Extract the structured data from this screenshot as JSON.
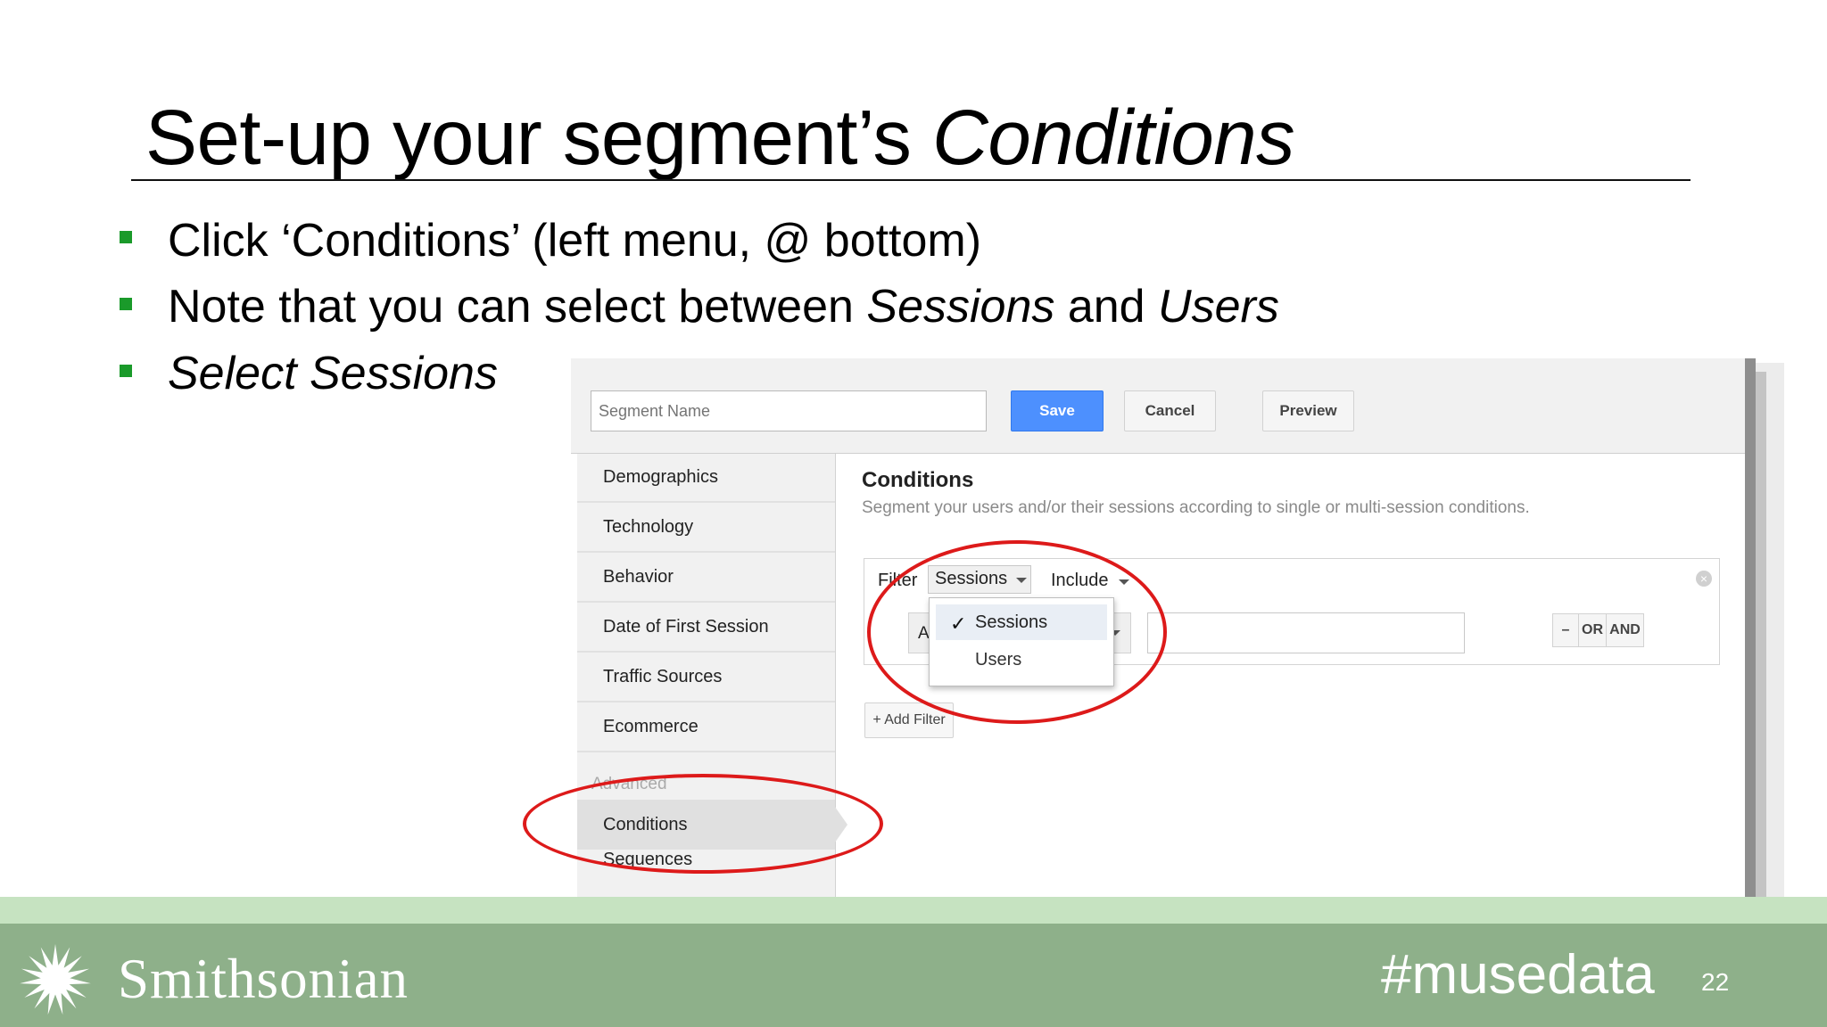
{
  "slide": {
    "title_main": "Set-up your segment’s ",
    "title_emph": "Conditions",
    "bullets": [
      {
        "p1": "Click ‘Conditions’ (left menu, @ bottom)"
      },
      {
        "p1": "Note that you can select between ",
        "e1": "Sessions",
        "p2": " and ",
        "e2": "Users"
      },
      {
        "e1": "Select",
        "p1": " ",
        "e2": "Sessions"
      }
    ],
    "bullet_color": "#1a9a2a"
  },
  "toolbar": {
    "segment_name_placeholder": "Segment Name",
    "save_label": "Save",
    "cancel_label": "Cancel",
    "preview_label": "Preview"
  },
  "nav": {
    "items": [
      "Demographics",
      "Technology",
      "Behavior",
      "Date of First Session",
      "Traffic Sources",
      "Ecommerce"
    ],
    "advanced_label": "Advanced",
    "active_item": "Conditions",
    "after_item": "Sequences"
  },
  "conditions": {
    "title": "Conditions",
    "subtitle": "Segment your users and/or their sessions according to single or multi-session conditions.",
    "filter_label": "Filter",
    "scope_value": "Sessions",
    "include_value": "Include",
    "attribute_value": "A",
    "dropdown_options": [
      "Sessions",
      "Users"
    ],
    "minus_label": "–",
    "or_label": "OR",
    "and_label": "AND",
    "add_filter_label": "+ Add Filter"
  },
  "footer": {
    "brand": "Smithsonian",
    "hashtag": "#musedata",
    "page_number": "22"
  },
  "colors": {
    "accent_save": "#4d90fe",
    "annotation_red": "#dd1a1a",
    "footer_green": "#8eb08a"
  }
}
